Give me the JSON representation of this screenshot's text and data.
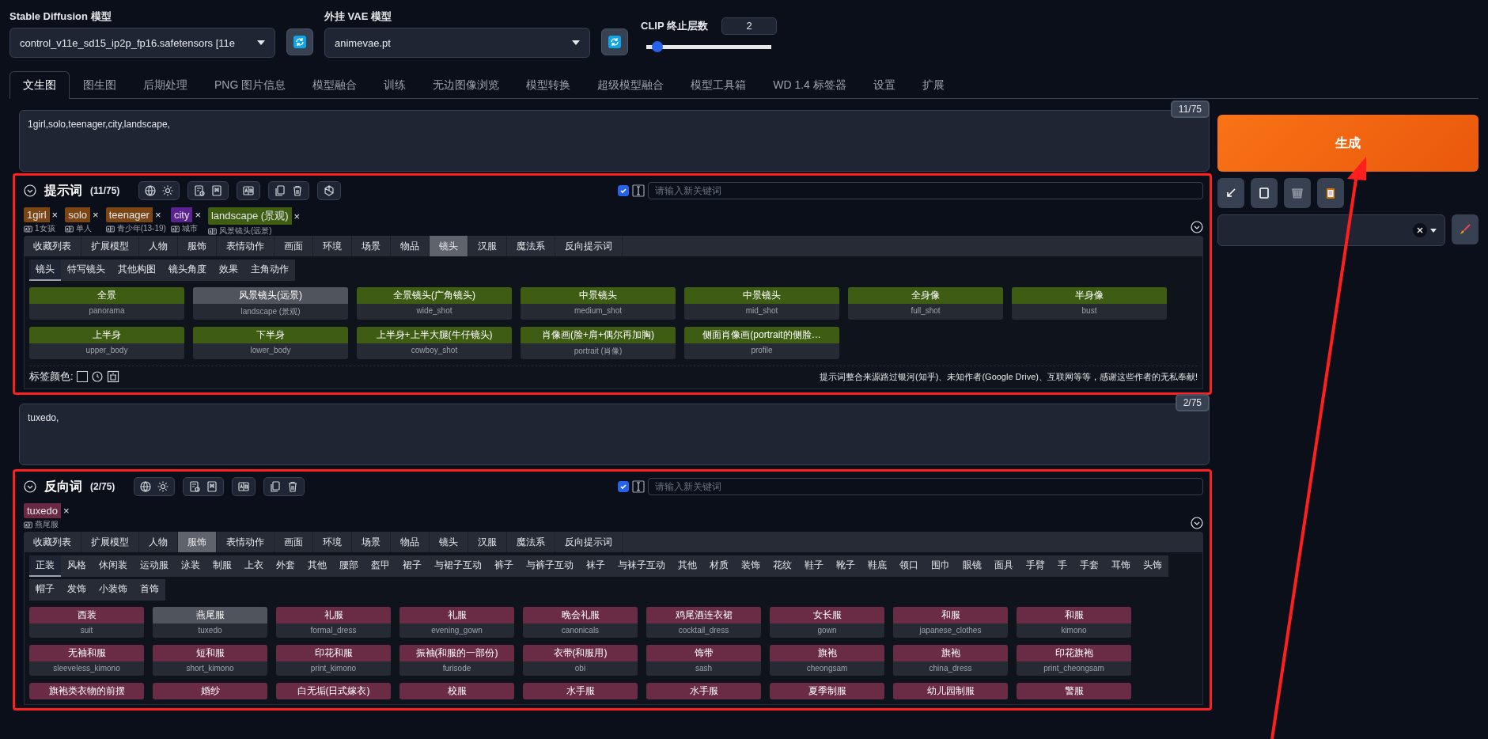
{
  "models": [
    {
      "label": "Stable Diffusion 模型",
      "value": "control_v11e_sd15_ip2p_fp16.safetensors [11e"
    },
    {
      "label": "外挂 VAE 模型",
      "value": "animevae.pt"
    }
  ],
  "clip": {
    "label": "CLIP 终止层数",
    "value": "2",
    "level": 0.09
  },
  "tabs": [
    {
      "label": "文生图",
      "selected": true
    },
    {
      "label": "图生图",
      "selected": false
    },
    {
      "label": "后期处理",
      "selected": false
    },
    {
      "label": "PNG 图片信息",
      "selected": false
    },
    {
      "label": "模型融合",
      "selected": false
    },
    {
      "label": "训练",
      "selected": false
    },
    {
      "label": "无边图像浏览",
      "selected": false
    },
    {
      "label": "模型转换",
      "selected": false
    },
    {
      "label": "超级模型融合",
      "selected": false
    },
    {
      "label": "模型工具箱",
      "selected": false
    },
    {
      "label": "WD 1.4 标签器",
      "selected": false
    },
    {
      "label": "设置",
      "selected": false
    },
    {
      "label": "扩展",
      "selected": false
    }
  ],
  "prompts": [
    {
      "kind": "positive",
      "text": "1girl,solo,teenager,city,landscape,",
      "count": "11/75",
      "title": "提示词",
      "title_count": "(11/75)",
      "keyword_checked": true,
      "placeholder": "请输入新关键词",
      "tags": [
        {
          "text": "1girl",
          "remove": "×",
          "translation": "1女孩",
          "color": "#7b4514"
        },
        {
          "text": "solo",
          "remove": "×",
          "translation": "单人",
          "color": "#7b4514"
        },
        {
          "text": "teenager",
          "remove": "×",
          "translation": "青少年(13-19)",
          "color": "#7b4514"
        },
        {
          "text": "city",
          "remove": "×",
          "translation": "城市",
          "color": "#5b2290"
        },
        {
          "text": "landscape (景观)",
          "remove": "×",
          "translation": "风景镜头(远景)",
          "color": "#3f5e12"
        }
      ],
      "categories": [
        {
          "label": "收藏列表",
          "selected": false
        },
        {
          "label": "扩展模型",
          "selected": false
        },
        {
          "label": "人物",
          "selected": false
        },
        {
          "label": "服饰",
          "selected": false
        },
        {
          "label": "表情动作",
          "selected": false
        },
        {
          "label": "画面",
          "selected": false
        },
        {
          "label": "环境",
          "selected": false
        },
        {
          "label": "场景",
          "selected": false
        },
        {
          "label": "物品",
          "selected": false
        },
        {
          "label": "镜头",
          "selected": true
        },
        {
          "label": "汉服",
          "selected": false
        },
        {
          "label": "魔法系",
          "selected": false
        },
        {
          "label": "反向提示词",
          "selected": false
        }
      ],
      "subcategories": [
        {
          "label": "镜头",
          "selected": true
        },
        {
          "label": "特写镜头",
          "selected": false
        },
        {
          "label": "其他构图",
          "selected": false
        },
        {
          "label": "镜头角度",
          "selected": false
        },
        {
          "label": "效果",
          "selected": false
        },
        {
          "label": "主角动作",
          "selected": false
        }
      ],
      "cards": [
        {
          "label": "全景",
          "value": "panorama",
          "selected": false
        },
        {
          "label": "风景镜头(远景)",
          "value": "landscape (景观)",
          "selected": true
        },
        {
          "label": "全景镜头(广角镜头)",
          "value": "wide_shot",
          "selected": false
        },
        {
          "label": "中景镜头",
          "value": "medium_shot",
          "selected": false
        },
        {
          "label": "中景镜头",
          "value": "mid_shot",
          "selected": false
        },
        {
          "label": "全身像",
          "value": "full_shot",
          "selected": false
        },
        {
          "label": "半身像",
          "value": "bust",
          "selected": false
        },
        {
          "label": "上半身",
          "value": "upper_body",
          "selected": false
        },
        {
          "label": "下半身",
          "value": "lower_body",
          "selected": false
        },
        {
          "label": "上半身+上半大腿(牛仔镜头)",
          "value": "cowboy_shot",
          "selected": false
        },
        {
          "label": "肖像画(脸+肩+偶尔再加胸)",
          "value": "portrait (肖像)",
          "selected": false
        },
        {
          "label": "侧面肖像画(portrait的侧脸…",
          "value": "profile",
          "selected": false
        }
      ],
      "footer": {
        "label": "标签颜色:",
        "credit": "提示词整合来源路过银河(知乎)、未知作者(Google Drive)、互联网等等，感谢这些作者的无私奉献!"
      }
    },
    {
      "kind": "negative",
      "text": "tuxedo,",
      "count": "2/75",
      "title": "反向词",
      "title_count": "(2/75)",
      "keyword_checked": true,
      "placeholder": "请输入新关键词",
      "tags": [
        {
          "text": "tuxedo",
          "remove": "×",
          "translation": "燕尾服",
          "color": "#6b2a44"
        }
      ],
      "categories": [
        {
          "label": "收藏列表",
          "selected": false
        },
        {
          "label": "扩展模型",
          "selected": false
        },
        {
          "label": "人物",
          "selected": false
        },
        {
          "label": "服饰",
          "selected": true
        },
        {
          "label": "表情动作",
          "selected": false
        },
        {
          "label": "画面",
          "selected": false
        },
        {
          "label": "环境",
          "selected": false
        },
        {
          "label": "场景",
          "selected": false
        },
        {
          "label": "物品",
          "selected": false
        },
        {
          "label": "镜头",
          "selected": false
        },
        {
          "label": "汉服",
          "selected": false
        },
        {
          "label": "魔法系",
          "selected": false
        },
        {
          "label": "反向提示词",
          "selected": false
        }
      ],
      "subcategories": [
        {
          "label": "正装",
          "selected": true
        },
        {
          "label": "风格",
          "selected": false
        },
        {
          "label": "休闲装",
          "selected": false
        },
        {
          "label": "运动服",
          "selected": false
        },
        {
          "label": "泳装",
          "selected": false
        },
        {
          "label": "制服",
          "selected": false
        },
        {
          "label": "上衣",
          "selected": false
        },
        {
          "label": "外套",
          "selected": false
        },
        {
          "label": "其他",
          "selected": false
        },
        {
          "label": "腰部",
          "selected": false
        },
        {
          "label": "盔甲",
          "selected": false
        },
        {
          "label": "裙子",
          "selected": false
        },
        {
          "label": "与裙子互动",
          "selected": false
        },
        {
          "label": "裤子",
          "selected": false
        },
        {
          "label": "与裤子互动",
          "selected": false
        },
        {
          "label": "袜子",
          "selected": false
        },
        {
          "label": "与袜子互动",
          "selected": false
        },
        {
          "label": "其他",
          "selected": false
        },
        {
          "label": "材质",
          "selected": false
        },
        {
          "label": "装饰",
          "selected": false
        },
        {
          "label": "花纹",
          "selected": false
        },
        {
          "label": "鞋子",
          "selected": false
        },
        {
          "label": "靴子",
          "selected": false
        },
        {
          "label": "鞋底",
          "selected": false
        },
        {
          "label": "领口",
          "selected": false
        },
        {
          "label": "围巾",
          "selected": false
        },
        {
          "label": "眼镜",
          "selected": false
        },
        {
          "label": "面具",
          "selected": false
        },
        {
          "label": "手臂",
          "selected": false
        },
        {
          "label": "手",
          "selected": false
        },
        {
          "label": "手套",
          "selected": false
        },
        {
          "label": "耳饰",
          "selected": false
        },
        {
          "label": "头饰",
          "selected": false
        },
        {
          "label": "帽子",
          "selected": false
        },
        {
          "label": "发饰",
          "selected": false
        },
        {
          "label": "小装饰",
          "selected": false
        },
        {
          "label": "首饰",
          "selected": false
        }
      ],
      "cards": [
        {
          "label": "西装",
          "value": "suit",
          "selected": false
        },
        {
          "label": "燕尾服",
          "value": "tuxedo",
          "selected": true
        },
        {
          "label": "礼服",
          "value": "formal_dress",
          "selected": false
        },
        {
          "label": "礼服",
          "value": "evening_gown",
          "selected": false
        },
        {
          "label": "晚会礼服",
          "value": "canonicals",
          "selected": false
        },
        {
          "label": "鸡尾酒连衣裙",
          "value": "cocktail_dress",
          "selected": false
        },
        {
          "label": "女长服",
          "value": "gown",
          "selected": false
        },
        {
          "label": "和服",
          "value": "japanese_clothes",
          "selected": false
        },
        {
          "label": "和服",
          "value": "kimono",
          "selected": false
        },
        {
          "label": "无袖和服",
          "value": "sleeveless_kimono",
          "selected": false
        },
        {
          "label": "短和服",
          "value": "short_kimono",
          "selected": false
        },
        {
          "label": "印花和服",
          "value": "print_kimono",
          "selected": false
        },
        {
          "label": "振袖(和服的一部份)",
          "value": "furisode",
          "selected": false
        },
        {
          "label": "衣带(和服用)",
          "value": "obi",
          "selected": false
        },
        {
          "label": "饰带",
          "value": "sash",
          "selected": false
        },
        {
          "label": "旗袍",
          "value": "cheongsam",
          "selected": false
        },
        {
          "label": "旗袍",
          "value": "china_dress",
          "selected": false
        },
        {
          "label": "印花旗袍",
          "value": "print_cheongsam",
          "selected": false
        },
        {
          "label": "旗袍类衣物的前摆",
          "selected": false
        },
        {
          "label": "婚纱",
          "selected": false
        },
        {
          "label": "白无垢(日式嫁衣)",
          "selected": false
        },
        {
          "label": "校服",
          "selected": false
        },
        {
          "label": "水手服",
          "selected": false
        },
        {
          "label": "水手服",
          "selected": false
        },
        {
          "label": "夏季制服",
          "selected": false
        },
        {
          "label": "幼儿园制服",
          "selected": false
        },
        {
          "label": "警服",
          "selected": false
        }
      ]
    }
  ],
  "generate": {
    "label": "生成"
  }
}
